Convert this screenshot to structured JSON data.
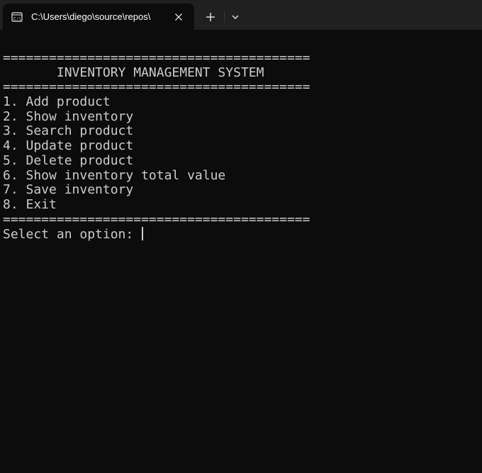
{
  "tab": {
    "title": "C:\\Users\\diego\\source\\repos\\"
  },
  "terminal": {
    "separator": "========================================",
    "header": "       INVENTORY MANAGEMENT SYSTEM",
    "menu": [
      "1. Add product",
      "2. Show inventory",
      "3. Search product",
      "4. Update product",
      "5. Delete product",
      "6. Show inventory total value",
      "7. Save inventory",
      "8. Exit"
    ],
    "prompt": "Select an option: "
  },
  "icons": {
    "tab": "terminal-icon",
    "close": "close-icon",
    "new_tab": "plus-icon",
    "dropdown": "chevron-down-icon"
  },
  "colors": {
    "background": "#0c0c0c",
    "titlebar": "#202020",
    "text": "#cccccc"
  }
}
